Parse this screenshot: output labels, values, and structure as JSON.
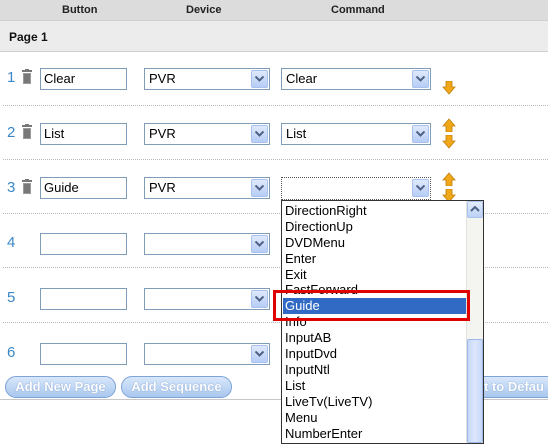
{
  "header": {
    "button_col": "Button",
    "device_col": "Device",
    "command_col": "Command"
  },
  "page": {
    "title": "Page 1"
  },
  "rows": [
    {
      "num": "1",
      "button": "Clear",
      "device": "PVR",
      "command": "Clear"
    },
    {
      "num": "2",
      "button": "List",
      "device": "PVR",
      "command": "List"
    },
    {
      "num": "3",
      "button": "Guide",
      "device": "PVR",
      "command": ""
    },
    {
      "num": "4",
      "button": "",
      "device": "",
      "command": ""
    },
    {
      "num": "5",
      "button": "",
      "device": "",
      "command": ""
    },
    {
      "num": "6",
      "button": "",
      "device": "",
      "command": ""
    }
  ],
  "dropdown": {
    "items": [
      "DirectionRight",
      "DirectionUp",
      "DVDMenu",
      "Enter",
      "Exit",
      "FastForward",
      "Guide",
      "Info",
      "InputAB",
      "InputDvd",
      "InputNtl",
      "List",
      "LiveTv(LiveTV)",
      "Menu",
      "NumberEnter"
    ],
    "selected": "Guide"
  },
  "buttons": {
    "add_page": "Add New Page",
    "add_sequence": "Add Sequence",
    "reset_partial": "t to Defau"
  },
  "colors": {
    "accent": "#316ac5",
    "highlight_border": "#e00000",
    "row_number": "#3b87c8",
    "arrow": "#f0a818"
  }
}
